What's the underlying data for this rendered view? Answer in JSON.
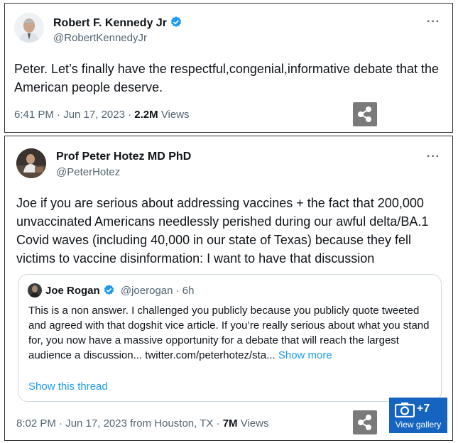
{
  "tweet1": {
    "name": "Robert F. Kennedy Jr",
    "handle": "@RobertKennedyJr",
    "text": "Peter. Let’s finally have the respectful,congenial,informative debate that the American people deserve.",
    "time": "6:41 PM · Jun 17, 2023 ·",
    "views_count": "2.2M",
    "views_label": "Views"
  },
  "tweet2": {
    "name": "Prof Peter Hotez MD PhD",
    "handle": "@PeterHotez",
    "text": "Joe if you are serious about addressing vaccines + the fact that 200,000 unvaccinated Americans needlessly perished during our awful delta/BA.1 Covid waves (including 40,000 in our state of Texas) because they fell victims to vaccine disinformation: I want to have that discussion",
    "time": "8:02 PM · Jun 17, 2023 from Houston, TX ·",
    "views_count": "7M",
    "views_label": "Views"
  },
  "quote": {
    "name": "Joe Rogan",
    "handle_time": "@joerogan · 6h",
    "text": "This is a non answer.  I challenged you publicly because you publicly quote tweeted and agreed with that dogshit vice article.  If you’re really serious about what you stand for, you now have a massive opportunity for a debate that will reach the largest audience a discussion... twitter.com/peterhotez/sta...",
    "show_more": "Show more",
    "show_thread": "Show this thread"
  },
  "gallery": {
    "count": "+7",
    "label": "View gallery"
  },
  "more_label": "···",
  "colors": {
    "link": "#1d9bf0",
    "verified": "#1d9bf0",
    "gallery_bg": "#1565c0"
  },
  "icons": [
    "more-icon",
    "verified-badge-icon",
    "share-icon",
    "camera-icon"
  ]
}
